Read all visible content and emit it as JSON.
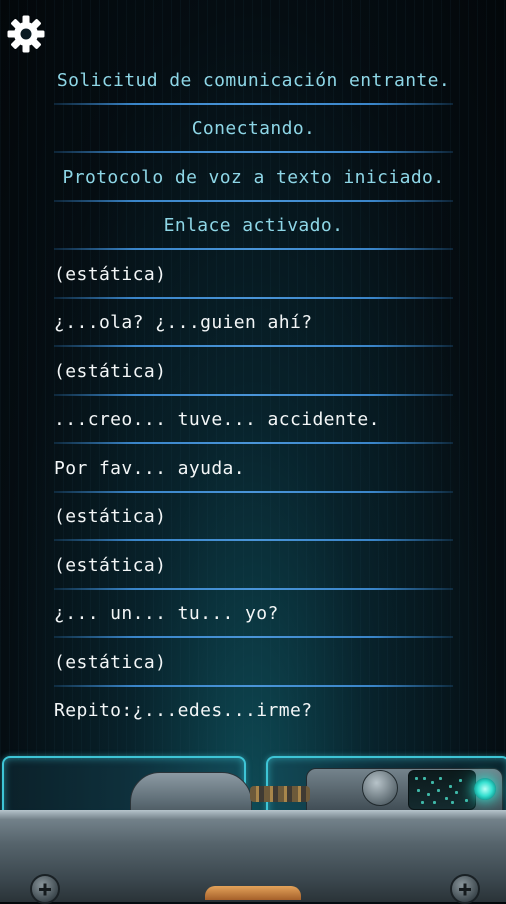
{
  "settings": {
    "icon": "gear-icon",
    "color": "#ffffff"
  },
  "log": [
    {
      "type": "system",
      "text": "Solicitud de comunicación entrante."
    },
    {
      "type": "system",
      "text": "Conectando."
    },
    {
      "type": "system",
      "text": "Protocolo de voz a texto iniciado."
    },
    {
      "type": "system",
      "text": "Enlace activado."
    },
    {
      "type": "message",
      "text": "(estática)"
    },
    {
      "type": "message",
      "text": "¿...ola? ¿...guien ahí?"
    },
    {
      "type": "message",
      "text": "(estática)"
    },
    {
      "type": "message",
      "text": "...creo... tuve... accidente."
    },
    {
      "type": "message",
      "text": "Por fav... ayuda."
    },
    {
      "type": "message",
      "text": "(estática)"
    },
    {
      "type": "message",
      "text": "(estática)"
    },
    {
      "type": "message",
      "text": "¿... un... tu... yo?"
    },
    {
      "type": "message",
      "text": "(estática)"
    },
    {
      "type": "message",
      "text": "Repito:¿...edes...irme?"
    }
  ],
  "colors": {
    "system_text": "#8ed6e6",
    "message_text": "#f3f6f7",
    "divider": "#3a85c9",
    "console_glow": "#3ec5d6",
    "indicator_light": "#35e0d0"
  }
}
